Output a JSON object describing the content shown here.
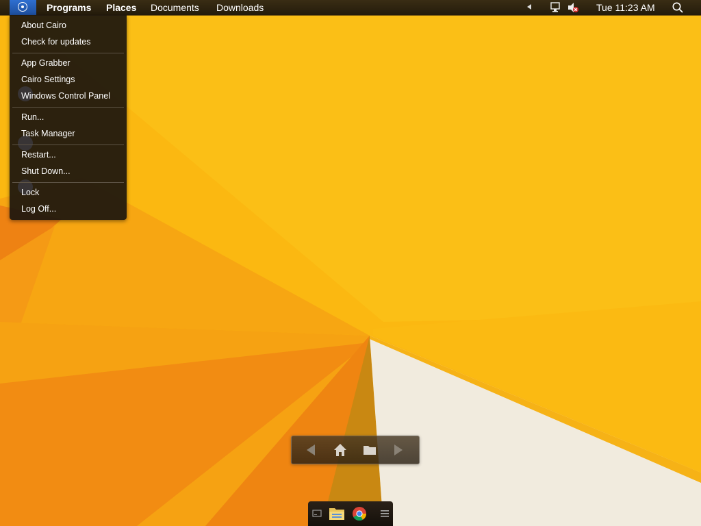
{
  "colors": {
    "wallpaper_main": "#fbb811",
    "wallpaper_orange": "#f08a12",
    "wallpaper_white": "#f0eadc",
    "menubar_bg": "#2b2112",
    "cairo_button_bg": "#2a62c2",
    "menu_bg": "#1c160e"
  },
  "menubar": {
    "cairo_button_icon": "cairo-logo-icon",
    "items": {
      "programs": "Programs",
      "places": "Places",
      "documents": "Documents",
      "downloads": "Downloads"
    },
    "tray": {
      "arrow_icon": "caret-left-icon",
      "network_icon": "network-icon",
      "volume_icon": "volume-muted-icon"
    },
    "clock": "Tue 11:23 AM",
    "search_icon": "search-icon"
  },
  "cairo_menu": {
    "groups": [
      {
        "items": [
          "About Cairo",
          "Check for updates"
        ]
      },
      {
        "items": [
          "App Grabber",
          "Cairo Settings",
          "Windows Control Panel"
        ]
      },
      {
        "items": [
          "Run...",
          "Task Manager"
        ]
      },
      {
        "items": [
          "Restart...",
          "Shut Down..."
        ]
      },
      {
        "items": [
          "Lock",
          "Log Off..."
        ]
      }
    ]
  },
  "nav_toolbar": {
    "icons": [
      "back-arrow-icon",
      "home-icon",
      "folder-icon",
      "forward-arrow-icon"
    ]
  },
  "taskbar": {
    "icons": [
      "desktop-icon",
      "file-explorer-icon",
      "chrome-icon",
      "menu-icon"
    ]
  }
}
